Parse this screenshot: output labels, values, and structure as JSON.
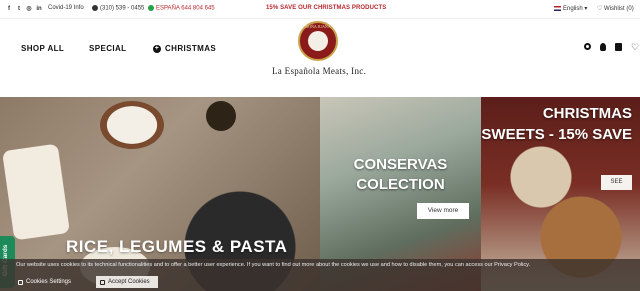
{
  "topbar": {
    "social_icons": [
      "facebook-icon",
      "twitter-icon",
      "instagram-icon",
      "linkedin-icon"
    ],
    "covid_link": "Covid-19 Info",
    "phone": "(310) 539 - 0455",
    "spain_phone": "ESPAÑA 644 804 645",
    "promo": "15% SAVE OUR CHRISTMAS PRODUCTS",
    "language": "English",
    "wishlist": "Wishlist (0)"
  },
  "nav": {
    "shop_all": "SHOP ALL",
    "special": "SPECIAL",
    "christmas": "CHRISTMAS"
  },
  "brand": {
    "logo_text": "DOÑA JUANA",
    "company": "La Española Meats, Inc."
  },
  "hero": {
    "panel1_title": "RICE, LEGUMES & PASTA",
    "panel2_title": "CONSERVAS COLECTION",
    "panel2_button": "View more",
    "panel3_title": "CHRISTMAS SWEETS - 15% SAVE",
    "panel3_button": "SEE"
  },
  "gift_tab": "Gift Cards",
  "cookie": {
    "text": "Our website uses cookies to its technical functionalities and to offer a better user experience. If you want to find out more about the cookies we use and how to disable them, you can access our Privacy Policy.",
    "settings_label": "Cookies Settings",
    "accept_label": "Accept Cookies"
  },
  "colors": {
    "promo_red": "#b8272d",
    "gift_green": "#1d8a5a"
  }
}
